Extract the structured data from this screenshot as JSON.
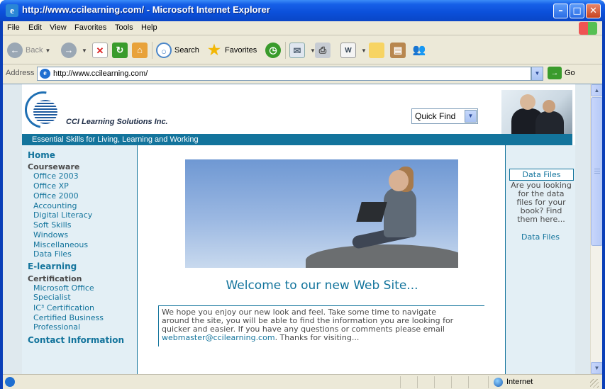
{
  "window": {
    "title": "http://www.ccilearning.com/ - Microsoft Internet Explorer",
    "minimize": "–",
    "maximize": "□",
    "close": "✕"
  },
  "menu": [
    "File",
    "Edit",
    "View",
    "Favorites",
    "Tools",
    "Help"
  ],
  "toolbar": {
    "back": "Back",
    "search": "Search",
    "favorites": "Favorites"
  },
  "address": {
    "label": "Address",
    "url": "http://www.ccilearning.com/",
    "go": "Go"
  },
  "site": {
    "brand": "CCI Learning Solutions Inc.",
    "quick_find": "Quick Find",
    "tagline": "Essential Skills for Living, Learning and Working",
    "nav": {
      "home": "Home",
      "courseware": "Courseware",
      "courseware_items": [
        "Office 2003",
        "Office XP",
        "Office 2000",
        "Accounting",
        "Digital Literacy",
        "Soft Skills",
        "Windows",
        "Miscellaneous",
        "Data Files"
      ],
      "elearning": "E-learning",
      "certification": "Certification",
      "certification_items": [
        "Microsoft Office",
        "Specialist",
        "IC³ Certification",
        "Certified Business",
        "Professional"
      ],
      "contact": "Contact Information"
    },
    "welcome": "Welcome to our new Web Site...",
    "intro_lines": [
      "We hope you enjoy our new look and feel. Take some time to navigate",
      "around the site, you will be able to find the information you are looking for",
      "quicker and easier. If you have any questions or comments please email"
    ],
    "intro_email": "webmaster@ccilearning.com",
    "intro_end": ". Thanks for visiting...",
    "datafiles": {
      "button": "Data Files",
      "text_lines": [
        "Are you looking",
        "for the data",
        "files for your",
        "book? Find",
        "them here..."
      ],
      "link": "Data Files"
    }
  },
  "status": {
    "zone": "Internet"
  },
  "colors": {
    "accent": "#13749c",
    "panel": "#e3eff5",
    "xp_title": "#0b4fd9"
  }
}
